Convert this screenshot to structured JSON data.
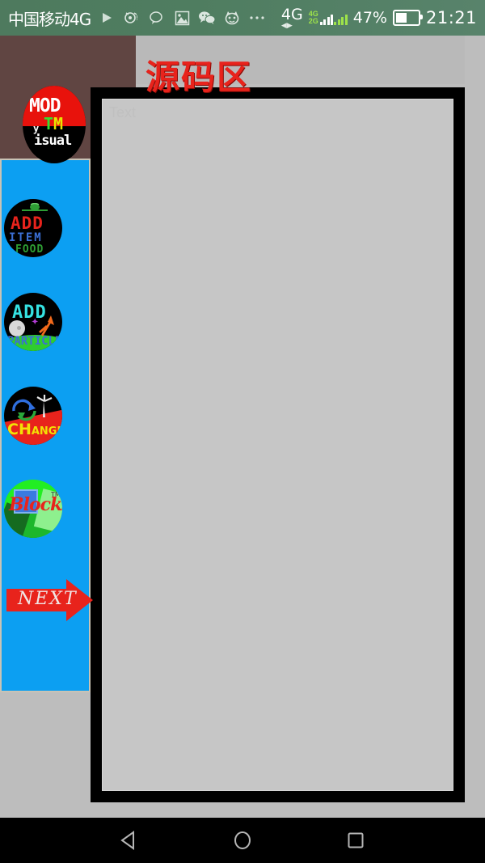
{
  "status_bar": {
    "carrier": "中国移动4G",
    "icons": [
      {
        "name": "play-icon",
        "glyph": "▶"
      },
      {
        "name": "alarm-notification-icon",
        "glyph": "◎"
      },
      {
        "name": "message-icon",
        "glyph": "💬"
      },
      {
        "name": "gallery-icon",
        "glyph": "🖼"
      },
      {
        "name": "wechat-icon",
        "glyph": "💬"
      },
      {
        "name": "cat-app-icon",
        "glyph": "🐱"
      },
      {
        "name": "more-icon",
        "glyph": "…"
      }
    ],
    "network_primary": "4G",
    "network_sim1": "4G",
    "network_sim2": "2G",
    "battery_percent": "47%",
    "clock": "21:21",
    "background_color": "#4f7d60",
    "text_color": "#ffffff",
    "signal_accent_color": "#9ee34a"
  },
  "app": {
    "title": "源码区",
    "title_color": "#e8231c",
    "background_color": "#bdbdbd",
    "header_color": "#604542",
    "sidebar_color": "#0c9ff2",
    "logo": {
      "name": "mod-visual-logo",
      "line1": "MOD",
      "line2_t": "T",
      "line2_m": "M",
      "mark_y": "y",
      "line3": "isual"
    },
    "buttons": [
      {
        "name": "add-item-food-button",
        "line1": "ADD",
        "line2": "ITEM",
        "line3": "FOOD",
        "color_line1": "#e8231c",
        "color_line2": "#3b6fd4",
        "color_line3": "#2e9e34"
      },
      {
        "name": "add-particle-button",
        "line1": "ADD",
        "line2": "PARTICLE",
        "color_line1": "#35e2e2",
        "color_line2": "#3b6fd4"
      },
      {
        "name": "change-button",
        "line1": "CH",
        "line2": "ANGE",
        "color_line1": "#f2e205"
      },
      {
        "name": "blocks-button",
        "line1": "Blocks",
        "trademark": "TM",
        "color_line1": "#e8231c"
      }
    ],
    "next_button": {
      "name": "next-arrow-button",
      "label": "NEXT",
      "arrow_color": "#e8231c",
      "label_color": "#f0e6e6"
    },
    "editor": {
      "name": "source-code-editor",
      "placeholder": "Text",
      "frame_color": "#000000",
      "surface_color": "#c6c6c6"
    }
  },
  "nav_bar": {
    "background_color": "#000000",
    "buttons": [
      {
        "name": "nav-back-button",
        "label": "Back"
      },
      {
        "name": "nav-home-button",
        "label": "Home"
      },
      {
        "name": "nav-recents-button",
        "label": "Recents"
      }
    ]
  }
}
